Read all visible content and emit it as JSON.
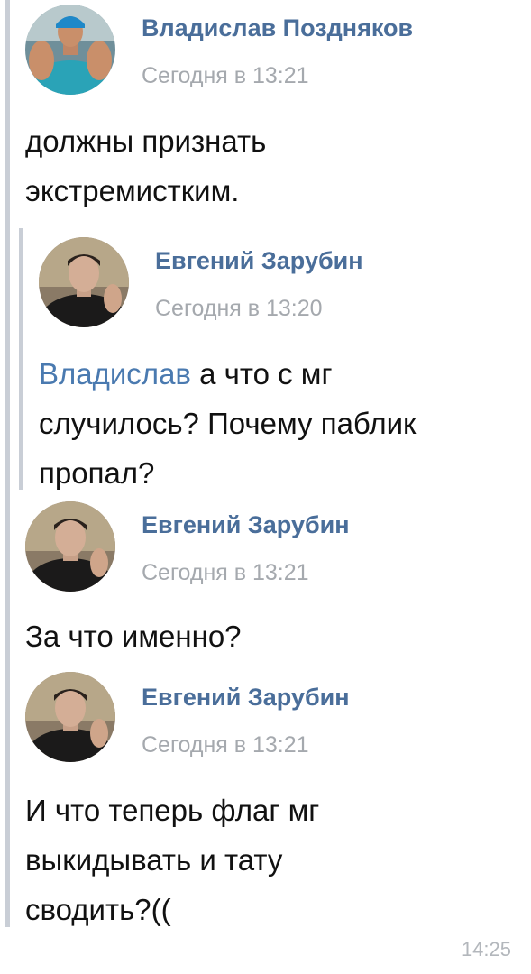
{
  "messages": [
    {
      "author": "Владислав Поздняков",
      "time": "Сегодня в 13:21",
      "text_lines": [
        "должны признать",
        "экстремистким."
      ]
    },
    {
      "author": "Евгений Зарубин",
      "time": "Сегодня в 13:20",
      "mention": "Владислав",
      "text_lines": [
        " а что с мг",
        "случилось? Почему паблик",
        "пропал?"
      ]
    },
    {
      "author": "Евгений Зарубин",
      "time": "Сегодня в 13:21",
      "text_lines": [
        "За что именно?"
      ]
    },
    {
      "author": "Евгений Зарубин",
      "time": "Сегодня в 13:21",
      "text_lines": [
        "И что теперь флаг мг",
        "выкидывать и тату",
        "сводить?(("
      ]
    }
  ],
  "footer": {
    "time": "14:25"
  },
  "icons": {
    "avatar_main": "avatar-vladislav",
    "avatar_other": "avatar-evgeny"
  },
  "colors": {
    "author": "#4a6e9a",
    "mention": "#4a7ab0",
    "meta": "#a5a9ae",
    "quote_bar": "#c9ced6"
  }
}
